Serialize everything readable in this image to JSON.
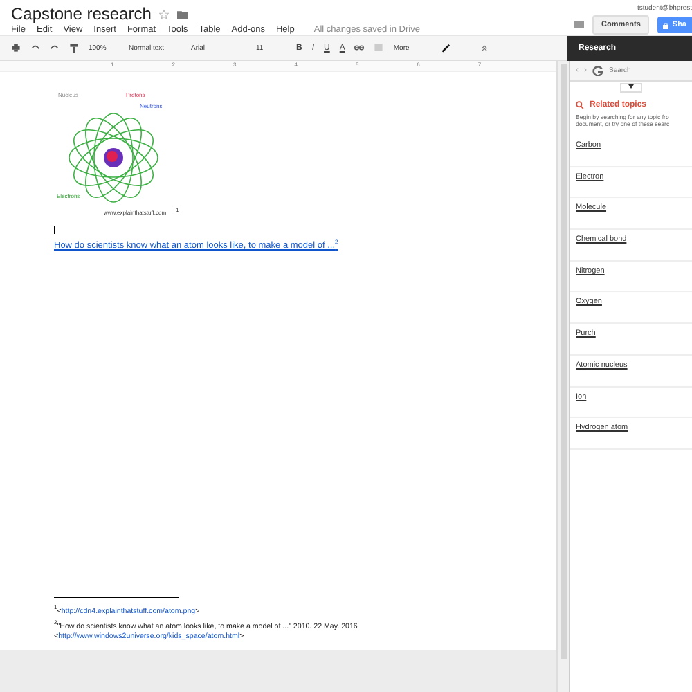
{
  "document": {
    "title": "Capstone research",
    "user": "tstudent@bhprest",
    "menu": [
      "File",
      "Edit",
      "View",
      "Insert",
      "Format",
      "Tools",
      "Table",
      "Add-ons",
      "Help"
    ],
    "save_status": "All changes saved in Drive",
    "comments_button": "Comments",
    "share_button": "Sha"
  },
  "toolbar": {
    "zoom": "100%",
    "style": "Normal text",
    "font": "Arial",
    "size": "11",
    "bold": "B",
    "italic": "I",
    "underline": "U",
    "text_color": "A",
    "more": "More"
  },
  "ruler": [
    "1",
    "2",
    "3",
    "4",
    "5",
    "6",
    "7"
  ],
  "figure": {
    "labels": [
      "Nucleus",
      "Protons",
      "Neutrons",
      "Electrons"
    ],
    "credit": "www.explainthatstuff.com",
    "footnote_mark": "1"
  },
  "link": {
    "text": "How do scientists know what an atom looks like, to make a model of ...",
    "footnote_mark": "2"
  },
  "footnotes": [
    {
      "mark": "1",
      "before": "<",
      "url": "http://cdn4.explainthatstuff.com/atom.png",
      "after": ">"
    },
    {
      "mark": "2",
      "text": "\"How do scientists know what an atom looks like, to make a model of ...\" 2010. 22 May. 2016"
    },
    {
      "before": "<",
      "url": "http://www.windows2universe.org/kids_space/atom.html",
      "after": ">"
    }
  ],
  "research": {
    "title": "Research",
    "back": "‹",
    "forward": "›",
    "search_placeholder": "Search",
    "section": "Related topics",
    "description": "Begin by searching for any topic fro document, or try one of these searc",
    "topics": [
      "Carbon",
      "Electron",
      "Molecule",
      "Chemical bond",
      "Nitrogen",
      "Oxygen",
      "Purch",
      "Atomic nucleus",
      "Ion",
      "Hydrogen atom"
    ]
  }
}
